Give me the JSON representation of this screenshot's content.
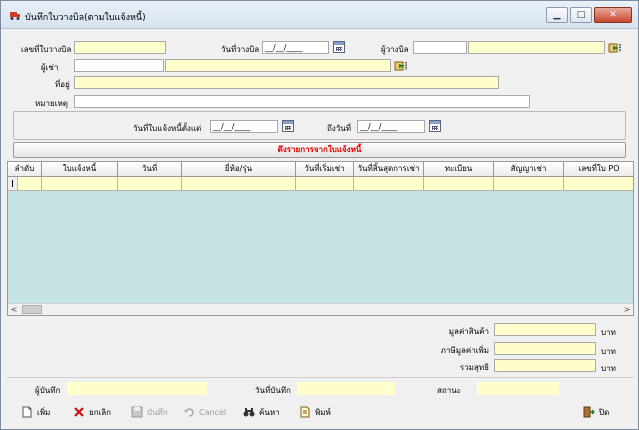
{
  "window": {
    "title": "บันทึกใบวางบิล(ตามใบแจ้งหนี้)",
    "controls": {
      "minimize": "▁",
      "maximize": "□",
      "close": "✕"
    }
  },
  "form": {
    "billing_no_label": "เลขที่ใบวางบิล",
    "billing_no": "",
    "billing_date_label": "วันที่วางบิล",
    "billing_date": "__/__/____",
    "biller_label": "ผู้วางบิล",
    "biller_code": "",
    "biller_name": "",
    "tenant_label": "ผู้เช่า",
    "tenant_code": "",
    "tenant_name": "",
    "address_label": "ที่อยู่",
    "address": "",
    "remark_label": "หมายเหตุ",
    "remark": "",
    "invoice_from_label": "วันที่ใบแจ้งหนี้ตั้งแต่",
    "invoice_from": "__/__/____",
    "to_date_label": "ถึงวันที่",
    "to_date": "__/__/____",
    "load_button": "ดึงรายการจากใบแจ้งหนี้"
  },
  "grid": {
    "columns": [
      "ลำดับ",
      "ใบแจ้งหนี้",
      "วันที่",
      "ยี่ห้อ/รุ่น",
      "วันที่เริ่มเช่า",
      "วันที่สิ้นสุดการเช่า",
      "ทะเบียน",
      "สัญญาเช่า",
      "เลขที่ใบ PO"
    ],
    "rows": [
      [
        "",
        "",
        "",
        "",
        "",
        "",
        "",
        "",
        ""
      ]
    ],
    "scroll_left": "<",
    "scroll_right": ">"
  },
  "totals": {
    "goods_value_label": "มูลค่าสินค้า",
    "goods_value": "",
    "vat_label": "ภาษีมูลค่าเพิ่ม",
    "vat": "",
    "net_label": "รวมสุทธิ",
    "net": "",
    "currency": "บาท"
  },
  "footer": {
    "recorded_by_label": "ผู้บันทึก",
    "recorded_by": "",
    "record_date_label": "วันที่บันทึก",
    "record_date": "",
    "status_label": "สถานะ",
    "status": ""
  },
  "toolbar": {
    "add": "เพิ่ม",
    "cancel_doc": "ยกเลิก",
    "save": "บันทึก",
    "cancel": "Cancel",
    "search": "ค้นหา",
    "print": "พิมพ์",
    "close": "ปิด"
  },
  "colors": {
    "input_bg": "#ffffcc",
    "grid_bg": "#c5e3e3",
    "accent_red": "#e00000"
  }
}
